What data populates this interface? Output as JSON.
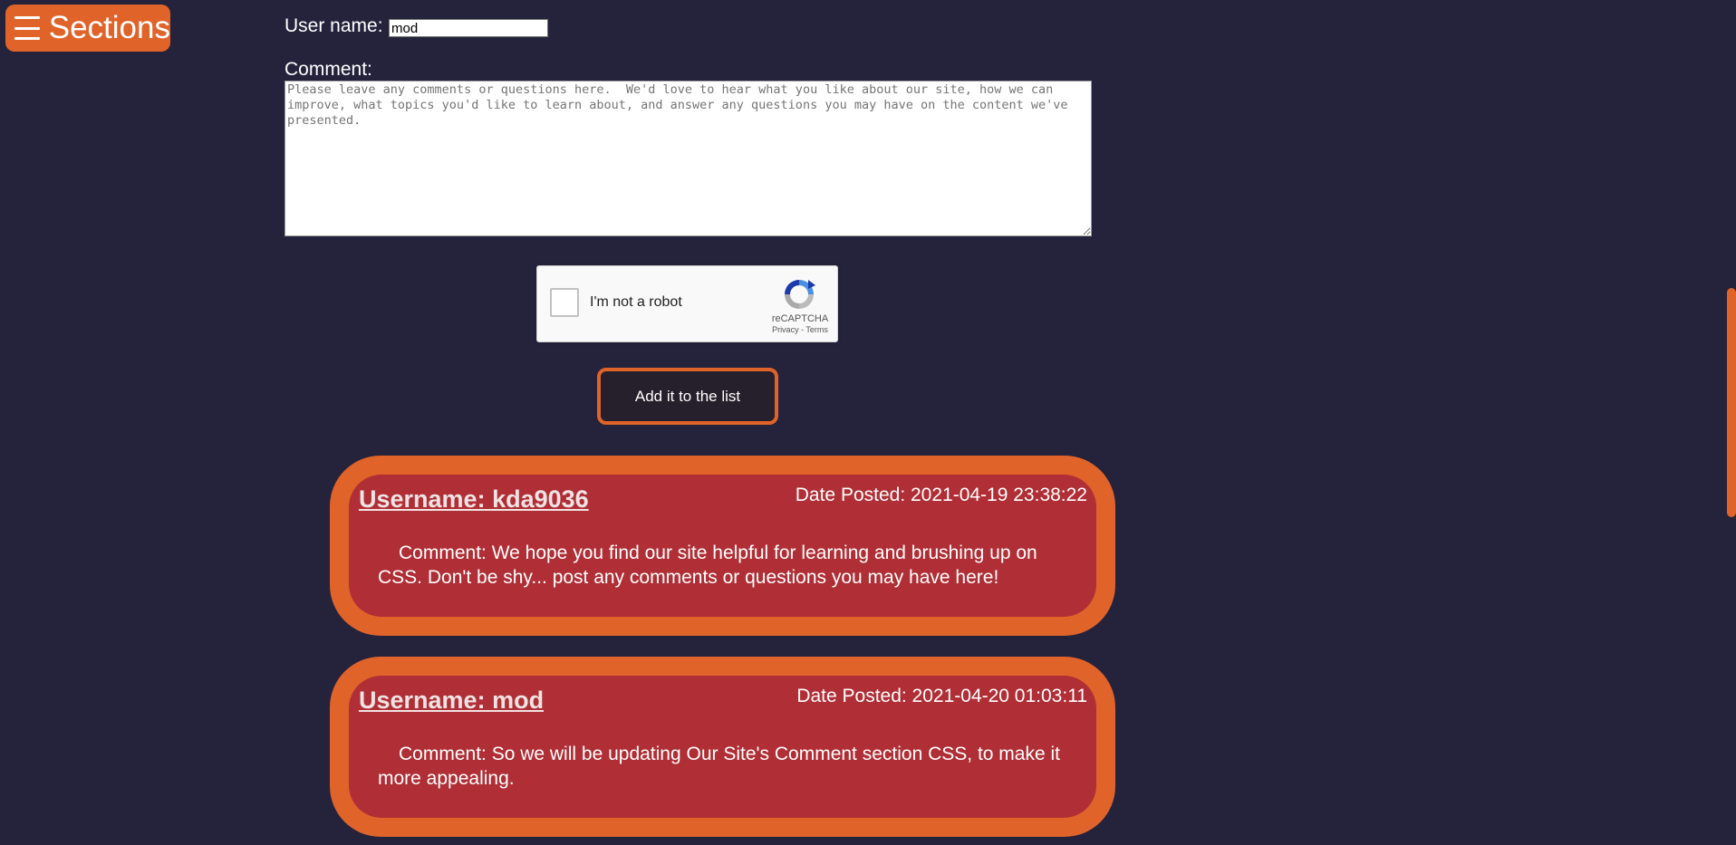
{
  "nav": {
    "sections_label": "Sections",
    "icon": "hamburger-menu-icon"
  },
  "form": {
    "username_label": "User name:",
    "username_value": "mod",
    "comment_label": "Comment:",
    "comment_placeholder": "Please leave any comments or questions here.  We'd love to hear what you like about our site, how we can improve, what topics you'd like to learn about, and answer any questions you may have on the content we've presented.",
    "recaptcha": {
      "checkbox_label": "I'm not a robot",
      "brand": "reCAPTCHA",
      "privacy": "Privacy",
      "separator": " - ",
      "terms": "Terms"
    },
    "submit_label": "Add it to the list"
  },
  "comments": [
    {
      "username": "Username: kda9036",
      "date": "Date Posted: 2021-04-19 23:38:22",
      "text": "Comment: We hope you find our site helpful for learning and brushing up on CSS. Don't be shy... post any comments or questions you may have here!"
    },
    {
      "username": "Username: mod",
      "date": "Date Posted: 2021-04-20 01:03:11",
      "text": "Comment: So we will be updating Our Site's Comment section CSS, to make it more appealing."
    }
  ],
  "colors": {
    "background": "#25223c",
    "accent": "#e06329",
    "card_inner": "#b02e35",
    "button_bg": "#25202b"
  }
}
